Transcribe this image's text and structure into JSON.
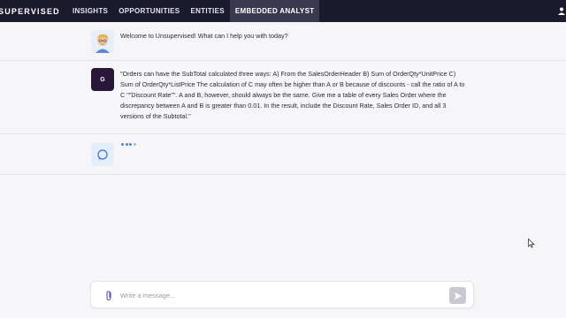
{
  "topbar": {
    "brand": "SUPERVISED",
    "nav": [
      {
        "label": "INSIGHTS",
        "active": false
      },
      {
        "label": "OPPORTUNITIES",
        "active": false
      },
      {
        "label": "ENTITIES",
        "active": false
      },
      {
        "label": "EMBEDDED ANALYST",
        "active": true
      }
    ]
  },
  "chat": {
    "messages": [
      {
        "role": "assistant",
        "avatar": "bot-avatar-icon",
        "text": "Welcome to Unsupervised! What can I help you with today?"
      },
      {
        "role": "user",
        "avatar_initial": "G",
        "text": "\"Orders can have the SubTotal calculated three ways: A) From the SalesOrderHeader B) Sum of OrderQty*UnitPrice C) Sum of OrderQty*ListPrice  The calculation of C may often be higher than A or B because of discounts - call the ratio of A to C \"\"Discount Rate\"\". A and B, however, should always be the same. Give me a table of every Sales Order where the discrepancy between A and B is greater than 0.01. In the result, include the Discount Rate, Sales Order ID, and all 3 versions of the Subtotal.\""
      },
      {
        "role": "assistant",
        "avatar": "loading-spinner-icon",
        "status": "typing"
      }
    ]
  },
  "composer": {
    "placeholder": "Write a message...",
    "value": "",
    "attach_icon": "paperclip-icon",
    "send_icon": "send-icon"
  },
  "colors": {
    "topbar_bg": "#1c1a2e",
    "active_tab_bg": "#3a3850",
    "user_avatar_bg": "#2a1638",
    "typing_dots": "#5b7fdc"
  }
}
